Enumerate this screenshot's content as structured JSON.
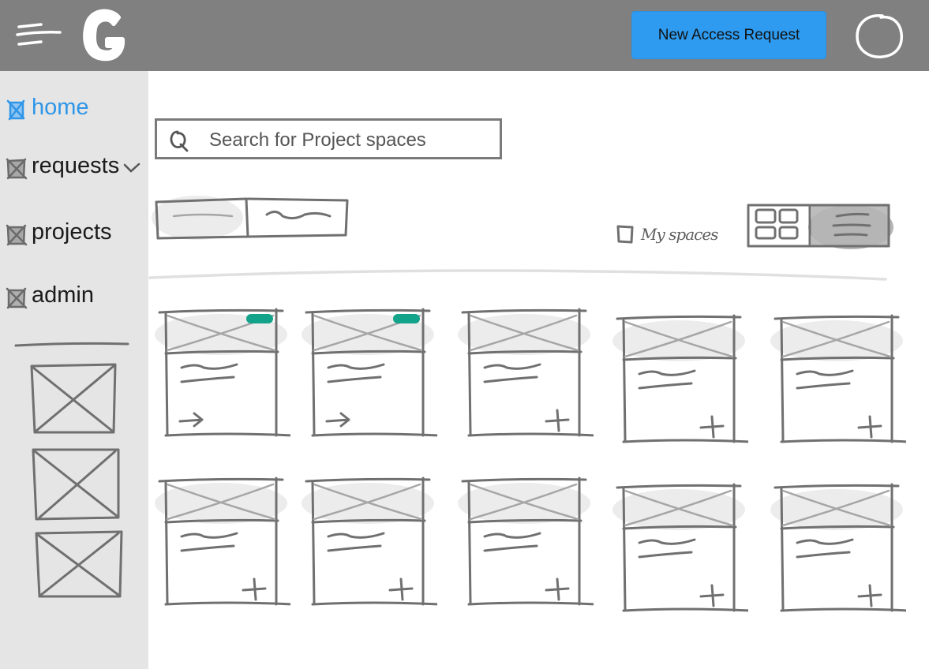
{
  "header": {
    "new_request_label": "New Access Request"
  },
  "sidebar": {
    "items": [
      {
        "label": "home",
        "active": true
      },
      {
        "label": "requests",
        "has_dropdown": true
      },
      {
        "label": "projects"
      },
      {
        "label": "admin"
      }
    ]
  },
  "search": {
    "placeholder": "Search for Project spaces"
  },
  "filters": {
    "my_spaces_label": "My spaces",
    "view_modes": [
      "grid",
      "list"
    ],
    "active_view": "list"
  },
  "cards": [
    {
      "action": "arrow",
      "badge": true
    },
    {
      "action": "arrow",
      "badge": true
    },
    {
      "action": "plus",
      "badge": false
    },
    {
      "action": "plus",
      "badge": false
    },
    {
      "action": "plus",
      "badge": false
    },
    {
      "action": "plus",
      "badge": false
    },
    {
      "action": "plus",
      "badge": false
    },
    {
      "action": "plus",
      "badge": false
    },
    {
      "action": "plus",
      "badge": false
    },
    {
      "action": "plus",
      "badge": false
    }
  ],
  "colors": {
    "header": "#808080",
    "sidebar": "#e5e5e5",
    "accent": "#2f9bf0",
    "active_nav": "#2f96e8",
    "badge": "#12a38a"
  }
}
